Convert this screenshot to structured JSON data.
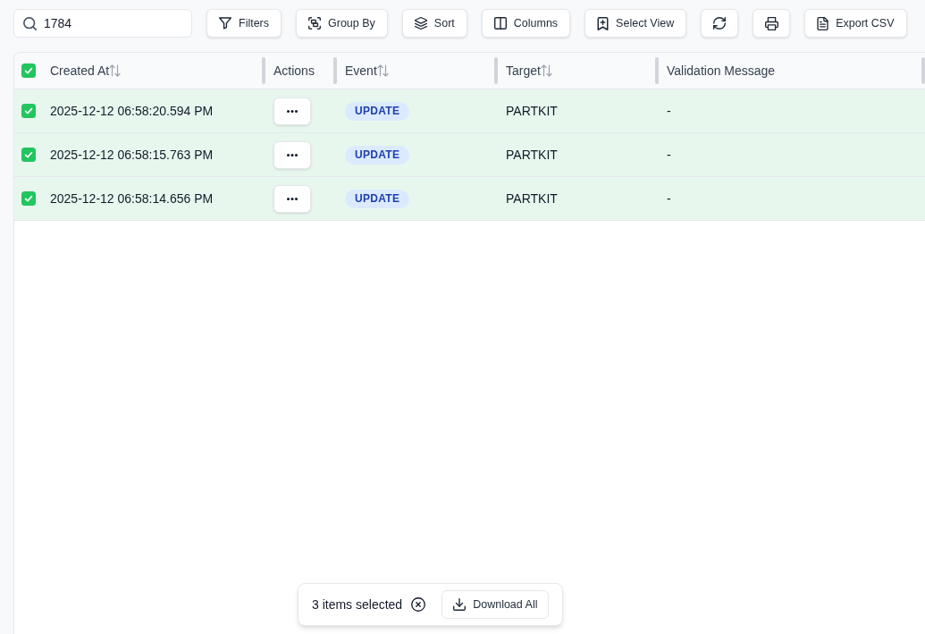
{
  "search": {
    "value": "1784"
  },
  "toolbar": {
    "buttons": [
      {
        "label": "Filters"
      },
      {
        "label": "Group By"
      },
      {
        "label": "Sort"
      },
      {
        "label": "Columns"
      },
      {
        "label": "Select View"
      }
    ],
    "export_button": {
      "label": "Export CSV"
    }
  },
  "table": {
    "all_selected": true,
    "columns": [
      {
        "label": "Created At",
        "sortable": true
      },
      {
        "label": "Actions",
        "sortable": false
      },
      {
        "label": "Event",
        "sortable": true
      },
      {
        "label": "Target",
        "sortable": true
      },
      {
        "label": "Validation Message",
        "sortable": false
      }
    ],
    "rows": [
      {
        "selected": true,
        "created_at": "2025-12-12 06:58:20.594 PM",
        "event": "UPDATE",
        "target": "PARTKIT",
        "validation_message": "-"
      },
      {
        "selected": true,
        "created_at": "2025-12-12 06:58:15.763 PM",
        "event": "UPDATE",
        "target": "PARTKIT",
        "validation_message": "-"
      },
      {
        "selected": true,
        "created_at": "2025-12-12 06:58:14.656 PM",
        "event": "UPDATE",
        "target": "PARTKIT",
        "validation_message": "-"
      }
    ]
  },
  "selection_bar": {
    "count": "3 items selected",
    "download_button": "Download All"
  }
}
